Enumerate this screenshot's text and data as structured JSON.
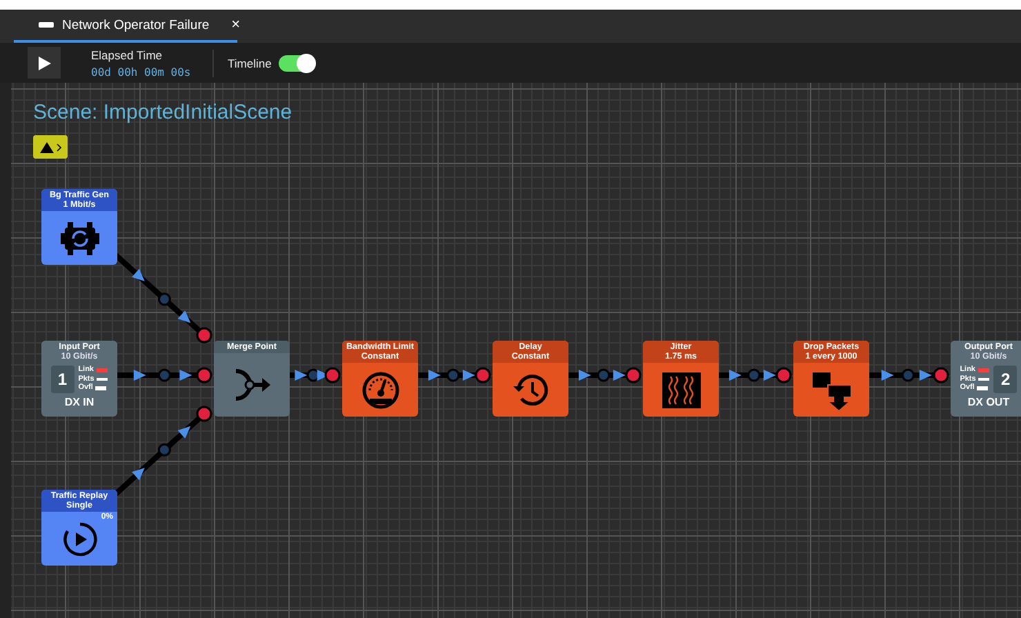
{
  "tab": {
    "title": "Network Operator Failure",
    "close": "×",
    "selected": true
  },
  "toolbar": {
    "elapsed_label": "Elapsed Time",
    "elapsed_value": "00d 00h 00m 00s",
    "timeline_label": "Timeline",
    "timeline_on": true
  },
  "scene_title": "Scene: ImportedInitialScene",
  "nodes": [
    {
      "kind": "source",
      "title": "Bg Traffic Gen",
      "subtitle": "1 Mbit/s"
    },
    {
      "kind": "port",
      "title": "Input Port",
      "subtitle": "10 Gbit/s",
      "number": "1",
      "label": "DX IN",
      "leds": [
        {
          "label": "Link",
          "active": true
        },
        {
          "label": "Pkts",
          "active": false
        },
        {
          "label": "Ovfl",
          "active": false
        }
      ]
    },
    {
      "kind": "source",
      "title": "Traffic Replay",
      "subtitle": "Single",
      "progress": "0%"
    },
    {
      "kind": "merge",
      "title": "Merge Point"
    },
    {
      "kind": "filter",
      "title": "Bandwidth Limit",
      "subtitle": "Constant"
    },
    {
      "kind": "filter",
      "title": "Delay",
      "subtitle": "Constant"
    },
    {
      "kind": "filter",
      "title": "Jitter",
      "subtitle": "1.75 ms"
    },
    {
      "kind": "filter",
      "title": "Drop Packets",
      "subtitle": "1 every 1000"
    },
    {
      "kind": "port",
      "title": "Output Port",
      "subtitle": "10 Gbit/s",
      "number": "2",
      "label": "DX OUT",
      "leds": [
        {
          "label": "Link",
          "active": true
        },
        {
          "label": "Pkts",
          "active": false
        },
        {
          "label": "Ovfl",
          "active": false
        }
      ]
    }
  ]
}
